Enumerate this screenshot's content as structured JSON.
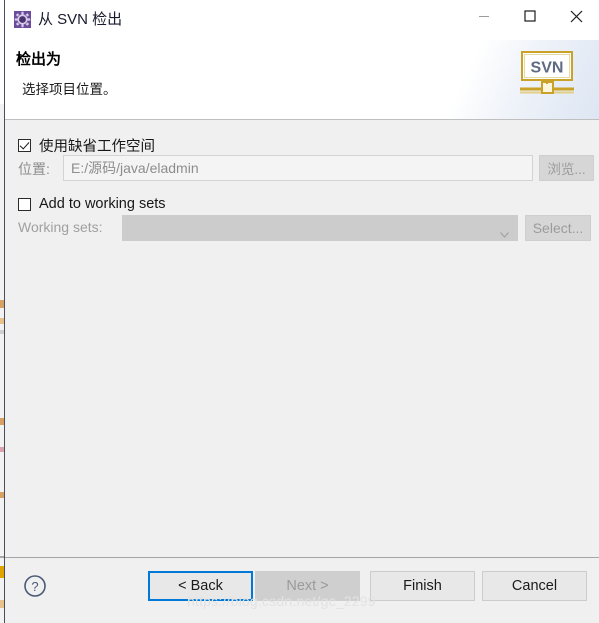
{
  "window": {
    "title": "从 SVN 检出",
    "app_icon": "svn-repository-icon",
    "controls": {
      "minimize": "minimize-icon",
      "maximize": "maximize-icon",
      "close": "close-icon"
    }
  },
  "header": {
    "title": "检出为",
    "subtitle": "选择项目位置。",
    "logo_text": "SVN",
    "logo_name": "svn-banner-logo"
  },
  "form": {
    "use_default_workspace": {
      "label": "使用缺省工作空间",
      "checked": true
    },
    "location": {
      "label": "位置:",
      "value": "E:/源码/java/eladmin",
      "placeholder": "",
      "browse_label": "浏览..."
    },
    "add_to_working_sets": {
      "label": "Add to working sets",
      "checked": false
    },
    "working_sets": {
      "label": "Working sets:",
      "value": "",
      "placeholder": "",
      "select_label": "Select..."
    }
  },
  "footer": {
    "help_label": "?",
    "back_label": "< Back",
    "next_label": "Next >",
    "finish_label": "Finish",
    "cancel_label": "Cancel",
    "watermark": "https://blog.csdn.net/gc_2299"
  },
  "colors": {
    "accent": "#0078d7",
    "dialog_bg": "#f0f0f0",
    "header_bg": "#ffffff",
    "disabled_text": "#9a9a9a",
    "title_icon_bg": "#6b4c9a",
    "svn_logo_gold": "#c9a227"
  }
}
